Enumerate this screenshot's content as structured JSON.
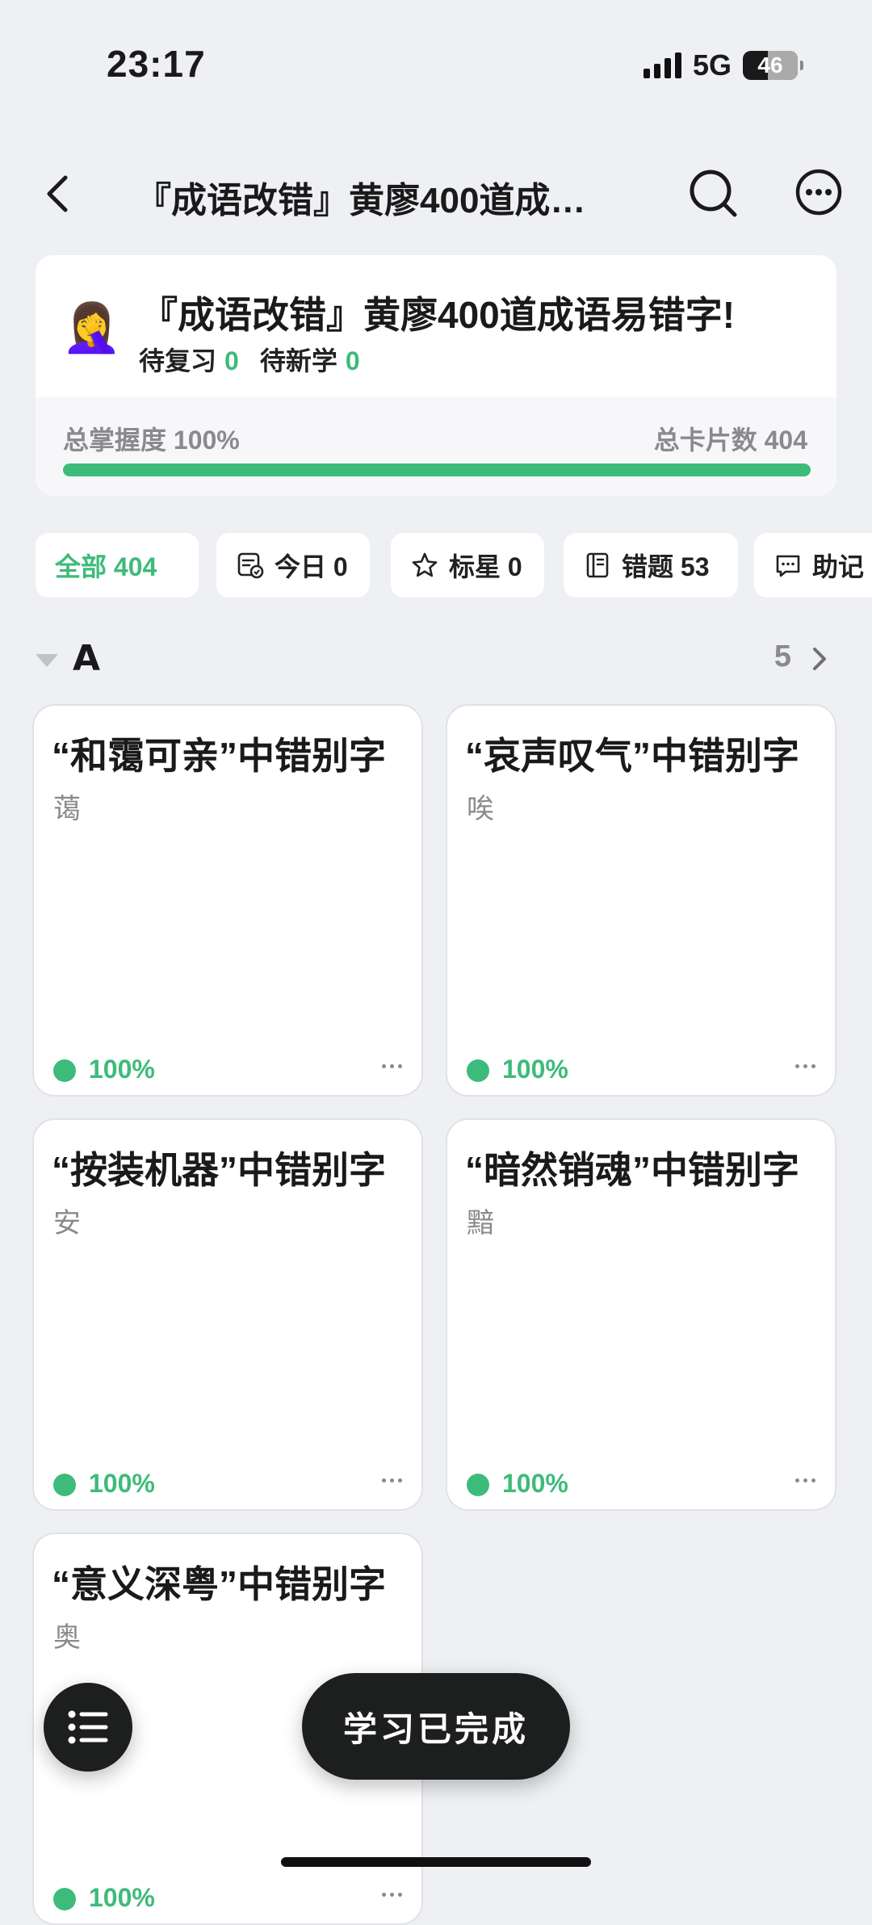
{
  "status_bar": {
    "time": "23:17",
    "network": "5G",
    "battery": "46"
  },
  "nav": {
    "title": "『成语改错』黄廖400道成…"
  },
  "deck": {
    "emoji": "🤦‍♀️",
    "name": "『成语改错』黄廖400道成语易错字!",
    "review_label": "待复习",
    "review_count": "0",
    "new_label": "待新学",
    "new_count": "0",
    "mastery_text": "总掌握度 100%",
    "mastery_value": 100,
    "total_text": "总卡片数 404"
  },
  "filters": [
    {
      "label": "全部 404",
      "icon": "none",
      "active": true
    },
    {
      "label": "今日 0",
      "icon": "calendar-check-icon",
      "active": false
    },
    {
      "label": "标星 0",
      "icon": "star-icon",
      "active": false
    },
    {
      "label": "错题 53",
      "icon": "notebook-icon",
      "active": false
    },
    {
      "label": "助记",
      "icon": "comment-icon",
      "active": false
    }
  ],
  "section": {
    "letter": "A",
    "count": "5"
  },
  "cards": [
    {
      "title": "“和霭可亲”中错别字",
      "answer": "蔼",
      "progress": "100%"
    },
    {
      "title": "“哀声叹气”中错别字",
      "answer": "唉",
      "progress": "100%"
    },
    {
      "title": "“按装机器”中错别字",
      "answer": "安",
      "progress": "100%"
    },
    {
      "title": "“暗然销魂”中错别字",
      "answer": "黯",
      "progress": "100%"
    },
    {
      "title": "“意义深粤”中错别字",
      "answer": "奥",
      "progress": "100%"
    }
  ],
  "floating": {
    "done_label": "学习已完成"
  },
  "colors": {
    "accent": "#3dbb7a",
    "background": "#eef0f4",
    "fab": "#1c1f1e"
  }
}
